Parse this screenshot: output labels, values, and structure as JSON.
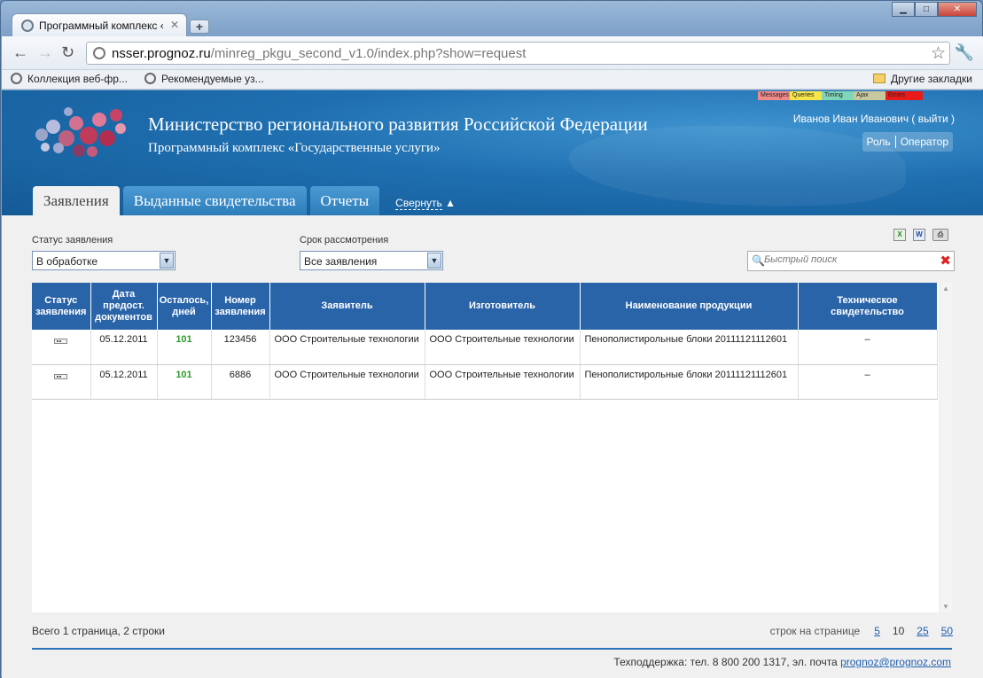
{
  "browser": {
    "tab_title": "Программный комплекс «",
    "url_host": "nsser.prognoz.ru",
    "url_path": "/minreg_pkgu_second_v1.0/index.php?show=request",
    "bookmarks": [
      {
        "label": "Коллекция веб-фр..."
      },
      {
        "label": "Рекомендуемые уз..."
      }
    ],
    "other_bookmarks": "Другие закладки"
  },
  "debug": {
    "items": [
      {
        "label": "Messages",
        "color": "#f08a8a"
      },
      {
        "label": "Queries",
        "color": "#f6e64a"
      },
      {
        "label": "Timing",
        "color": "#7fd6b8"
      },
      {
        "label": "Ajax",
        "color": "#c9c9a0"
      },
      {
        "label": "Errors",
        "color": "#e81a1a"
      }
    ]
  },
  "header": {
    "title": "Министерство регионального развития Российской Федерации",
    "subtitle": "Программный комплекс «Государственные услуги»",
    "user": "Иванов Иван Иванович ( выйти )",
    "role_label": "Роль",
    "role_value": "Оператор"
  },
  "tabs": [
    {
      "label": "Заявления",
      "active": true
    },
    {
      "label": "Выданные свидетельства",
      "active": false
    },
    {
      "label": "Отчеты",
      "active": false
    }
  ],
  "collapse_label": "Свернуть",
  "filters": {
    "status_label": "Статус заявления",
    "status_value": "В обработке",
    "term_label": "Срок рассмотрения",
    "term_value": "Все заявления"
  },
  "search": {
    "placeholder": "Быстрый поиск"
  },
  "table": {
    "headers": [
      "Статус заявления",
      "Дата предост. документов",
      "Осталось, дней",
      "Номер заявления",
      "Заявитель",
      "Изготовитель",
      "Наименование продукции",
      "Техническое свидетельство"
    ],
    "rows": [
      {
        "date": "05.12.2011",
        "days": "101",
        "number": "123456",
        "applicant": "ООО Строительные технологии",
        "maker": "ООО Строительные технологии",
        "product": "Пенополистирольные блоки 20111121112601",
        "cert": "–"
      },
      {
        "date": "05.12.2011",
        "days": "101",
        "number": "6886",
        "applicant": "ООО Строительные технологии",
        "maker": "ООО Строительные технологии",
        "product": "Пенополистирольные блоки 20111121112601",
        "cert": "–"
      }
    ]
  },
  "pager": {
    "info": "Всего 1 страница, 2 строки",
    "rows_label": "строк на странице",
    "options": [
      "5",
      "10",
      "25",
      "50"
    ],
    "current": "10"
  },
  "footer": {
    "text": "Техподдержка: тел. 8 800 200 1317, эл. почта",
    "email": "prognoz@prognoz.com"
  }
}
